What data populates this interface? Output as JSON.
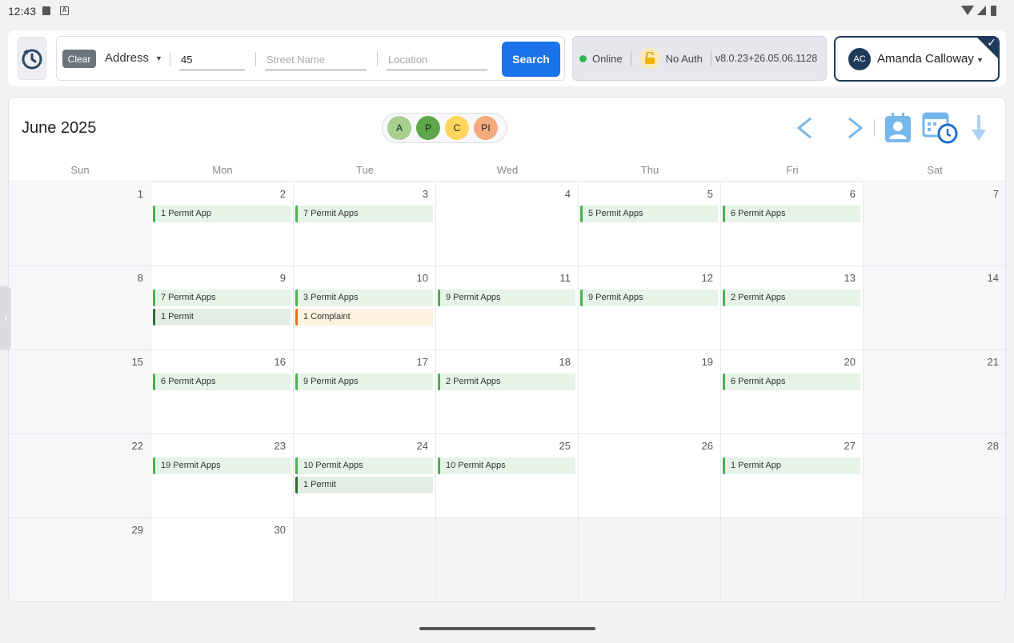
{
  "status": {
    "time": "12:43"
  },
  "search": {
    "clear_label": "Clear",
    "field_type": "Address",
    "number_value": "45",
    "street_placeholder": "Street Name",
    "location_placeholder": "Location",
    "search_label": "Search"
  },
  "info": {
    "online_label": "Online",
    "auth_label": "No Auth",
    "version": "v8.0.23+26.05.06.1128"
  },
  "user": {
    "initials": "AC",
    "name": "Amanda Calloway"
  },
  "calendar": {
    "title": "June 2025",
    "legend": [
      {
        "label": "A",
        "color": "#a8d08d"
      },
      {
        "label": "P",
        "color": "#5fa54a"
      },
      {
        "label": "C",
        "color": "#ffd55a"
      },
      {
        "label": "PI",
        "color": "#f4a97f"
      }
    ],
    "days_of_week": [
      "Sun",
      "Mon",
      "Tue",
      "Wed",
      "Thu",
      "Fri",
      "Sat"
    ],
    "weeks": [
      [
        {
          "day": "1",
          "events": []
        },
        {
          "day": "2",
          "events": [
            {
              "label": "1 Permit App",
              "kind": "app"
            }
          ]
        },
        {
          "day": "3",
          "events": [
            {
              "label": "7 Permit Apps",
              "kind": "app"
            }
          ]
        },
        {
          "day": "4",
          "events": []
        },
        {
          "day": "5",
          "events": [
            {
              "label": "5 Permit Apps",
              "kind": "app"
            }
          ]
        },
        {
          "day": "6",
          "events": [
            {
              "label": "6 Permit Apps",
              "kind": "app"
            }
          ]
        },
        {
          "day": "7",
          "events": []
        }
      ],
      [
        {
          "day": "8",
          "events": []
        },
        {
          "day": "9",
          "events": [
            {
              "label": "7 Permit Apps",
              "kind": "app"
            },
            {
              "label": "1 Permit",
              "kind": "permit"
            }
          ]
        },
        {
          "day": "10",
          "events": [
            {
              "label": "3 Permit Apps",
              "kind": "app"
            },
            {
              "label": "1 Complaint",
              "kind": "complaint"
            }
          ]
        },
        {
          "day": "11",
          "events": [
            {
              "label": "9 Permit Apps",
              "kind": "app"
            }
          ]
        },
        {
          "day": "12",
          "events": [
            {
              "label": "9 Permit Apps",
              "kind": "app"
            }
          ]
        },
        {
          "day": "13",
          "events": [
            {
              "label": "2 Permit Apps",
              "kind": "app"
            }
          ]
        },
        {
          "day": "14",
          "events": []
        }
      ],
      [
        {
          "day": "15",
          "events": []
        },
        {
          "day": "16",
          "events": [
            {
              "label": "6 Permit Apps",
              "kind": "app"
            }
          ]
        },
        {
          "day": "17",
          "events": [
            {
              "label": "9 Permit Apps",
              "kind": "app"
            }
          ]
        },
        {
          "day": "18",
          "events": [
            {
              "label": "2 Permit Apps",
              "kind": "app"
            }
          ]
        },
        {
          "day": "19",
          "events": []
        },
        {
          "day": "20",
          "events": [
            {
              "label": "6 Permit Apps",
              "kind": "app"
            }
          ]
        },
        {
          "day": "21",
          "events": []
        }
      ],
      [
        {
          "day": "22",
          "events": []
        },
        {
          "day": "23",
          "events": [
            {
              "label": "19 Permit Apps",
              "kind": "app"
            }
          ]
        },
        {
          "day": "24",
          "events": [
            {
              "label": "10 Permit Apps",
              "kind": "app"
            },
            {
              "label": "1 Permit",
              "kind": "permit"
            }
          ]
        },
        {
          "day": "25",
          "events": [
            {
              "label": "10 Permit Apps",
              "kind": "app"
            }
          ]
        },
        {
          "day": "26",
          "events": []
        },
        {
          "day": "27",
          "events": [
            {
              "label": "1 Permit App",
              "kind": "app"
            }
          ]
        },
        {
          "day": "28",
          "events": []
        }
      ],
      [
        {
          "day": "29",
          "events": []
        },
        {
          "day": "30",
          "events": []
        },
        {
          "day": "",
          "events": []
        },
        {
          "day": "",
          "events": []
        },
        {
          "day": "",
          "events": []
        },
        {
          "day": "",
          "events": []
        },
        {
          "day": "",
          "events": []
        }
      ]
    ]
  }
}
